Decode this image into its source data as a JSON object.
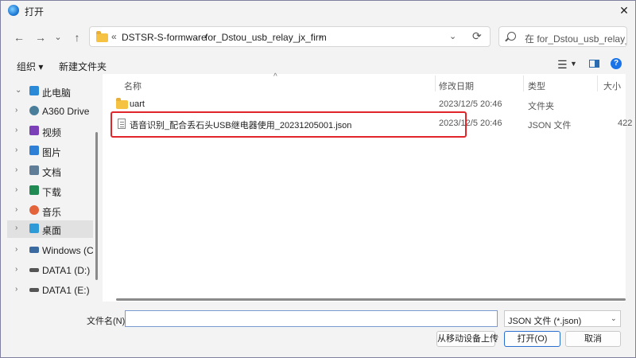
{
  "window": {
    "title": "打开",
    "close_glyph": "✕"
  },
  "nav_buttons": {
    "back": "←",
    "forward": "→",
    "dropdown": "⌄",
    "up": "↑"
  },
  "address": {
    "prefix": "«",
    "crumbs": [
      "DSTSR-S-formware",
      "for_Dstou_usb_relay_jx_firm"
    ],
    "separator": "›",
    "dropdown_glyph": "⌄",
    "refresh_glyph": "⟳"
  },
  "search": {
    "placeholder": "在 for_Dstou_usb_relay_jx_..."
  },
  "toolbar": {
    "organize": "组织 ▾",
    "new_folder": "新建文件夹",
    "view_glyph": "☰",
    "view_drop": "▼",
    "help": "?"
  },
  "sidebar": {
    "items": [
      {
        "label": "此电脑",
        "arrow": "⌄",
        "icon": "pc-icon",
        "color": "#2b8ad8"
      },
      {
        "label": "A360 Drive",
        "arrow": "›",
        "icon": "cloud-icon",
        "color": "#4a7d9a"
      },
      {
        "label": "视频",
        "arrow": "›",
        "icon": "video-icon",
        "color": "#7b3fb8"
      },
      {
        "label": "图片",
        "arrow": "›",
        "icon": "picture-icon",
        "color": "#2e7fd6"
      },
      {
        "label": "文档",
        "arrow": "›",
        "icon": "document-icon",
        "color": "#5f7d97"
      },
      {
        "label": "下载",
        "arrow": "›",
        "icon": "download-icon",
        "color": "#1f8a52"
      },
      {
        "label": "音乐",
        "arrow": "›",
        "icon": "music-icon",
        "color": "#e3643a"
      },
      {
        "label": "桌面",
        "arrow": "›",
        "icon": "desktop-icon",
        "color": "#2e9ad8",
        "selected": true
      },
      {
        "label": "Windows (C:)",
        "arrow": "›",
        "icon": "drive-windows-icon",
        "color": "#3a6aa0"
      },
      {
        "label": "DATA1 (D:)",
        "arrow": "›",
        "icon": "drive-icon",
        "color": "#555555"
      },
      {
        "label": "DATA1 (E:)",
        "arrow": "›",
        "icon": "drive-icon",
        "color": "#555555"
      }
    ]
  },
  "columns": {
    "name": "名称",
    "modified": "修改日期",
    "type": "类型",
    "size": "大小",
    "sort_glyph": "^"
  },
  "files": [
    {
      "name": "uart",
      "modified": "2023/12/5 20:46",
      "type": "文件夹",
      "size": "",
      "icon": "folder-icon"
    },
    {
      "name": "语音识别_配合丢石头USB继电器使用_20231205001.json",
      "modified": "2023/12/5 20:46",
      "type": "JSON 文件",
      "size": "422",
      "icon": "json-file-icon"
    }
  ],
  "bottom": {
    "filename_label": "文件名(N):",
    "filename_value": "",
    "filetype_value": "JSON 文件 (*.json)",
    "filetype_drop": "⌄",
    "mobile_button": "从移动设备上传",
    "open_button": "打开(O)",
    "cancel_button": "取消"
  },
  "colors": {
    "accent": "#2a6fd0",
    "highlight": "#e0262b",
    "folder": "#f5c242",
    "help": "#1a73e8"
  }
}
